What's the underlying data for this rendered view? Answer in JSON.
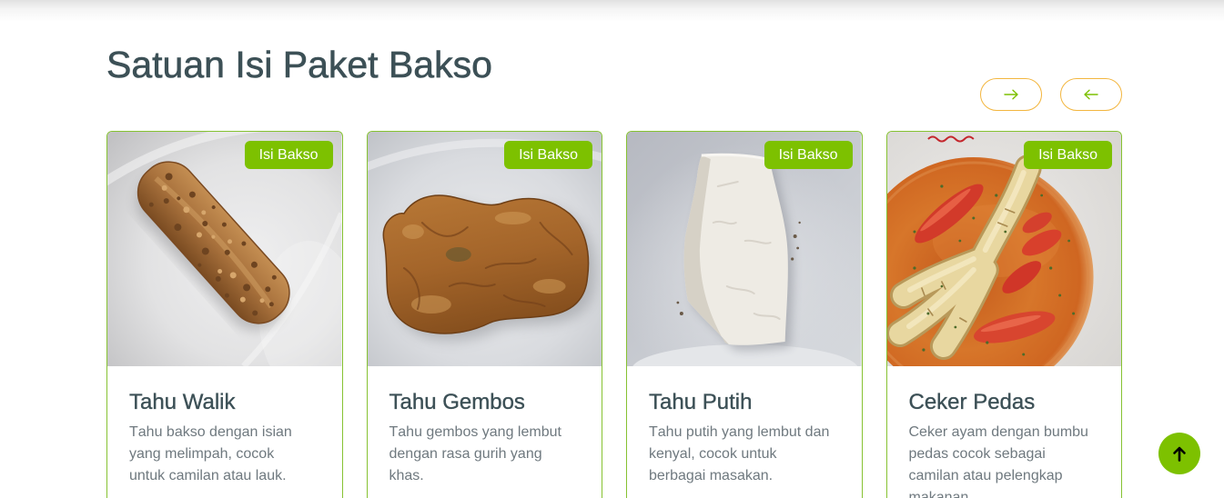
{
  "section": {
    "title": "Satuan Isi Paket Bakso"
  },
  "carousel_nav": {
    "next_icon": "arrow-right-icon",
    "prev_icon": "arrow-left-icon"
  },
  "cards": [
    {
      "badge": "Isi Bakso",
      "title": "Tahu Walik",
      "description": "Tahu bakso dengan isian yang melimpah, cocok untuk camilan atau lauk."
    },
    {
      "badge": "Isi Bakso",
      "title": "Tahu Gembos",
      "description": "Tahu gembos yang lembut dengan rasa gurih yang khas."
    },
    {
      "badge": "Isi Bakso",
      "title": "Tahu Putih",
      "description": "Tahu putih yang lembut dan kenyal, cocok untuk berbagai masakan."
    },
    {
      "badge": "Isi Bakso",
      "title": "Ceker Pedas",
      "description": "Ceker ayam dengan bumbu pedas cocok sebagai camilan atau pelengkap makanan."
    }
  ],
  "scroll_top": {
    "icon": "arrow-up-icon"
  },
  "colors": {
    "brand_green": "#7dc100",
    "heading": "#3c5056",
    "body_text": "#6f797f",
    "card_border": "#86c232",
    "nav_border": "#f3b63f",
    "background": "#ffffff"
  }
}
